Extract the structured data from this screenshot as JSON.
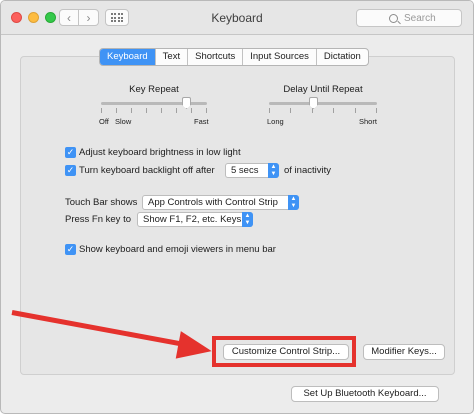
{
  "window": {
    "title": "Keyboard"
  },
  "search": {
    "placeholder": "Search"
  },
  "tabs": [
    {
      "label": "Keyboard",
      "active": true
    },
    {
      "label": "Text",
      "active": false
    },
    {
      "label": "Shortcuts",
      "active": false
    },
    {
      "label": "Input Sources",
      "active": false
    },
    {
      "label": "Dictation",
      "active": false
    }
  ],
  "key_repeat": {
    "label": "Key Repeat",
    "min_labels": [
      "Off",
      "Slow"
    ],
    "max_label": "Fast"
  },
  "delay_until_repeat": {
    "label": "Delay Until Repeat",
    "min_label": "Long",
    "max_label": "Short"
  },
  "options": {
    "adjust_brightness": {
      "label": "Adjust keyboard brightness in low light",
      "checked": true
    },
    "backlight_off": {
      "label_before": "Turn keyboard backlight off after",
      "value": "5 secs",
      "label_after": "of inactivity",
      "checked": true
    },
    "touch_bar_shows": {
      "label": "Touch Bar shows",
      "value": "App Controls with Control Strip"
    },
    "press_fn_key": {
      "label": "Press Fn key to",
      "value": "Show F1, F2, etc. Keys"
    },
    "show_viewers": {
      "label": "Show keyboard and emoji viewers in menu bar",
      "checked": true
    }
  },
  "buttons": {
    "customize_control_strip": "Customize Control Strip...",
    "modifier_keys": "Modifier Keys...",
    "bluetooth_keyboard": "Set Up Bluetooth Keyboard..."
  },
  "colors": {
    "accent": "#3f93f5",
    "highlight": "#e5322d"
  }
}
